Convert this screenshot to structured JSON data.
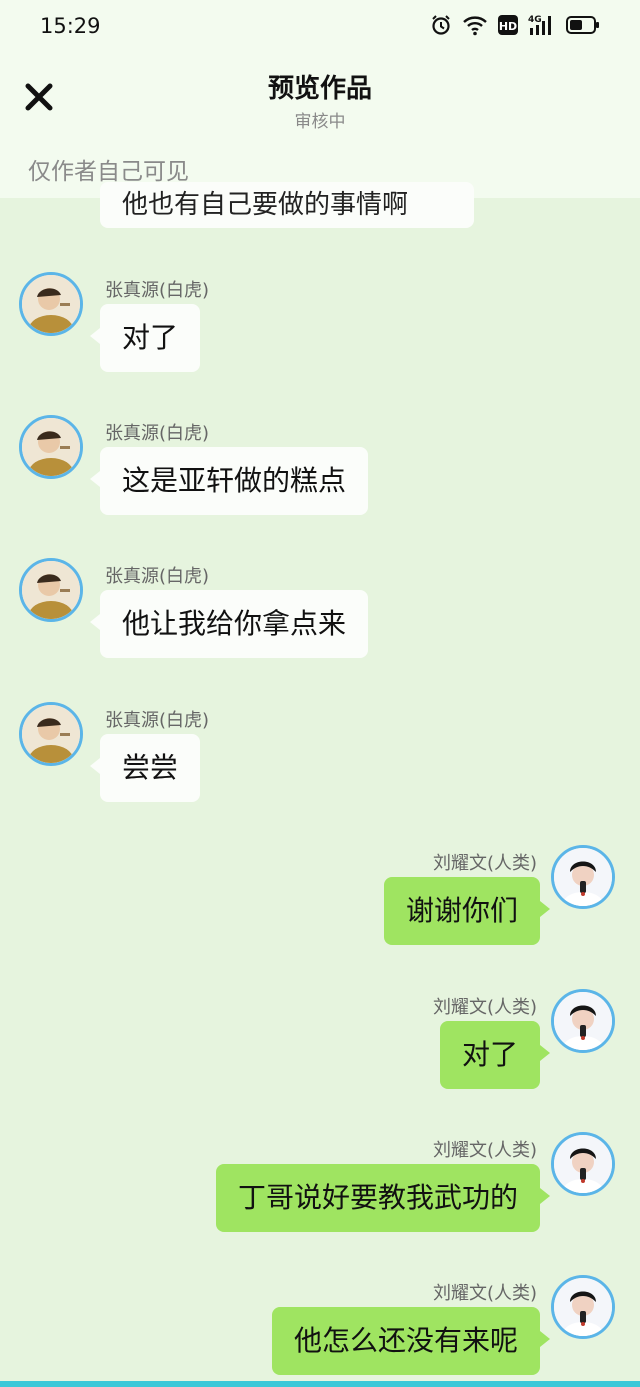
{
  "status": {
    "time": "15:29",
    "network": "4G",
    "hd": "HD"
  },
  "header": {
    "title": "预览作品",
    "subtitle": "审核中",
    "visibility": "仅作者自己可见"
  },
  "partial_message": "他也有自己要做的事情啊",
  "messages": [
    {
      "name": "张真源(白虎)",
      "text": "对了",
      "side": "left"
    },
    {
      "name": "张真源(白虎)",
      "text": "这是亚轩做的糕点",
      "side": "left"
    },
    {
      "name": "张真源(白虎)",
      "text": "他让我给你拿点来",
      "side": "left"
    },
    {
      "name": "张真源(白虎)",
      "text": "尝尝",
      "side": "left"
    },
    {
      "name": "刘耀文(人类)",
      "text": "谢谢你们",
      "side": "right"
    },
    {
      "name": "刘耀文(人类)",
      "text": "对了",
      "side": "right"
    },
    {
      "name": "刘耀文(人类)",
      "text": "丁哥说好要教我武功的",
      "side": "right"
    },
    {
      "name": "刘耀文(人类)",
      "text": "他怎么还没有来呢",
      "side": "right"
    }
  ],
  "colors": {
    "background": "#e6f4de",
    "header": "#f3fbef",
    "bubble_right": "#9fe461",
    "bubble_left": "#fbfdfa",
    "avatar_ring": "#5bb5e8"
  },
  "icons": [
    "alarm-icon",
    "wifi-icon",
    "hd-icon",
    "signal-4g-icon",
    "battery-icon",
    "close-icon"
  ]
}
